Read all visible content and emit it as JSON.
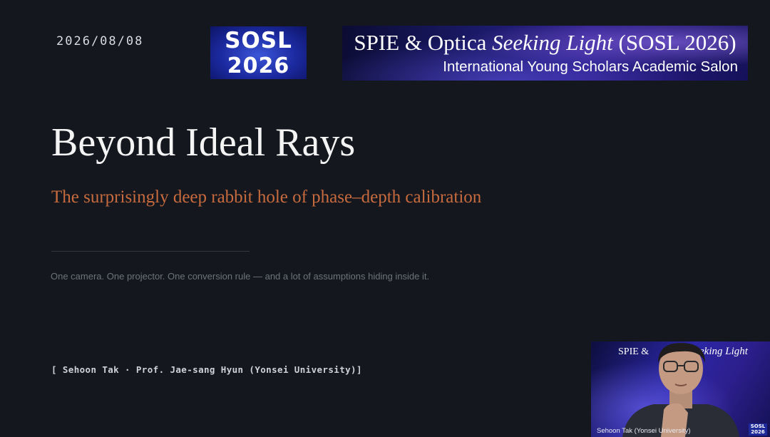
{
  "slide": {
    "date": "2026/08/08",
    "logo": {
      "line1": "SOSL",
      "line2": "2026"
    },
    "banner": {
      "line1_prefix": "SPIE & Optica ",
      "line1_italic": "Seeking Light",
      "line1_suffix": " (SOSL 2026)",
      "line2": "International Young Scholars Academic Salon"
    },
    "title": "Beyond Ideal Rays",
    "subtitle": "The surprisingly deep rabbit hole of phase–depth calibration",
    "tagline": "One camera. One projector. One conversion rule — and a lot of assumptions hiding inside it.",
    "authors": "[ Sehoon Tak · Prof. Jae-sang Hyun (Yonsei University)]"
  },
  "webcam": {
    "banner_left": "SPIE &",
    "banner_right": "eking Light",
    "name_label": "Sehoon Tak (Yonsei University)",
    "logo_line1": "SOSL",
    "logo_line2": "2026"
  },
  "colors": {
    "background": "#14171d",
    "title": "#f4f4f4",
    "subtitle": "#c76b3f",
    "tagline": "#6d727c"
  }
}
